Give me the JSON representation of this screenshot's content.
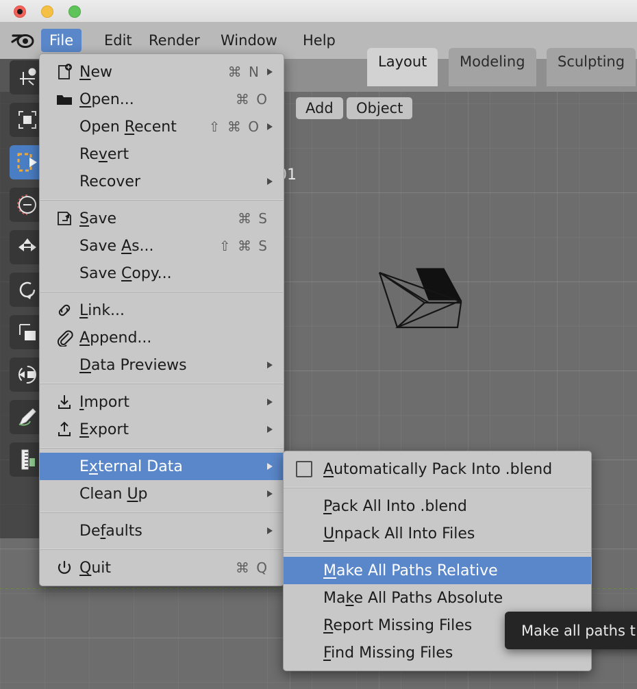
{
  "window": {
    "traffic_lights": [
      "close",
      "minimize",
      "maximize"
    ]
  },
  "topbar": {
    "logo": "blender-logo",
    "menus": [
      {
        "label": "File",
        "active": true
      },
      {
        "label": "Edit",
        "active": false
      },
      {
        "label": "Render",
        "active": false
      },
      {
        "label": "Window",
        "active": false
      },
      {
        "label": "Help",
        "active": false
      }
    ],
    "workspace_tabs": [
      {
        "label": "Layout",
        "selected": true
      },
      {
        "label": "Modeling",
        "selected": false
      },
      {
        "label": "Sculpting",
        "selected": false
      }
    ]
  },
  "viewport": {
    "header_buttons": [
      {
        "label": "Add"
      },
      {
        "label": "Object"
      }
    ],
    "overlay_text": "01",
    "object": "camera-wireframe"
  },
  "toolbar": {
    "tools": [
      {
        "name": "tweak-tool",
        "selected": false
      },
      {
        "name": "select-box-tool",
        "selected": false
      },
      {
        "name": "cursor-tool",
        "selected": true
      },
      {
        "name": "transform-tool",
        "selected": false
      },
      {
        "name": "move-tool",
        "selected": false
      },
      {
        "name": "rotate-tool",
        "selected": false
      },
      {
        "name": "scale-tool",
        "selected": false
      },
      {
        "name": "annotate-tool",
        "selected": false
      },
      {
        "name": "measure-tool",
        "selected": false
      }
    ]
  },
  "file_menu": {
    "groups": [
      {
        "items": [
          {
            "label": "New",
            "underline": "N",
            "icon": "new-file-icon",
            "accel": "⌘ N",
            "submenu": true
          },
          {
            "label": "Open...",
            "underline": "O",
            "icon": "folder-open-icon",
            "accel": "⌘ O",
            "submenu": false
          },
          {
            "label": "Open Recent",
            "underline": "R",
            "icon": "",
            "accel": "⇧ ⌘ O",
            "submenu": true
          },
          {
            "label": "Revert",
            "underline": "v",
            "icon": "",
            "accel": "",
            "submenu": false
          },
          {
            "label": "Recover",
            "underline": "",
            "icon": "",
            "accel": "",
            "submenu": true
          }
        ]
      },
      {
        "items": [
          {
            "label": "Save",
            "underline": "S",
            "icon": "save-icon",
            "accel": "⌘ S",
            "submenu": false
          },
          {
            "label": "Save As...",
            "underline": "A",
            "icon": "",
            "accel": "⇧ ⌘ S",
            "submenu": false
          },
          {
            "label": "Save Copy...",
            "underline": "C",
            "icon": "",
            "accel": "",
            "submenu": false
          }
        ]
      },
      {
        "items": [
          {
            "label": "Link...",
            "underline": "L",
            "icon": "link-icon",
            "accel": "",
            "submenu": false
          },
          {
            "label": "Append...",
            "underline": "p",
            "icon": "paperclip-icon",
            "accel": "",
            "submenu": false
          },
          {
            "label": "Data Previews",
            "underline": "D",
            "icon": "",
            "accel": "",
            "submenu": true
          }
        ]
      },
      {
        "items": [
          {
            "label": "Import",
            "underline": "I",
            "icon": "import-icon",
            "accel": "",
            "submenu": true
          },
          {
            "label": "Export",
            "underline": "E",
            "icon": "export-icon",
            "accel": "",
            "submenu": true
          }
        ]
      },
      {
        "items": [
          {
            "label": "External Data",
            "underline": "x",
            "icon": "",
            "accel": "",
            "submenu": true,
            "highlighted": true
          },
          {
            "label": "Clean Up",
            "underline": "U",
            "icon": "",
            "accel": "",
            "submenu": true
          }
        ]
      },
      {
        "items": [
          {
            "label": "Defaults",
            "underline": "f",
            "icon": "",
            "accel": "",
            "submenu": true
          }
        ]
      },
      {
        "items": [
          {
            "label": "Quit",
            "underline": "Q",
            "icon": "power-icon",
            "accel": "⌘ Q",
            "submenu": false
          }
        ]
      }
    ]
  },
  "external_data_menu": {
    "groups": [
      {
        "items": [
          {
            "label": "Automatically Pack Into .blend",
            "underline": "A",
            "checkbox": true,
            "checked": false,
            "highlighted": false
          }
        ]
      },
      {
        "items": [
          {
            "label": "Pack All Into .blend",
            "underline": "P",
            "checkbox": false,
            "highlighted": false
          },
          {
            "label": "Unpack All Into Files",
            "underline": "U",
            "checkbox": false,
            "highlighted": false
          }
        ]
      },
      {
        "items": [
          {
            "label": "Make All Paths Relative",
            "underline": "M",
            "checkbox": false,
            "highlighted": true
          },
          {
            "label": "Make All Paths Absolute",
            "underline": "k",
            "checkbox": false,
            "highlighted": false
          },
          {
            "label": "Report Missing Files",
            "underline": "R",
            "checkbox": false,
            "highlighted": false
          },
          {
            "label": "Find Missing Files",
            "underline": "F",
            "checkbox": false,
            "highlighted": false
          }
        ]
      }
    ]
  },
  "tooltip": {
    "text": "Make all paths t"
  },
  "colors": {
    "accent_blue": "#5a87c9",
    "menu_bg": "#c8c8c8",
    "topbar_bg": "#b9b9b9",
    "viewport_bg": "#6d6d6d",
    "tooltip_bg": "#252525",
    "axis_green": "#6b8b3e"
  }
}
